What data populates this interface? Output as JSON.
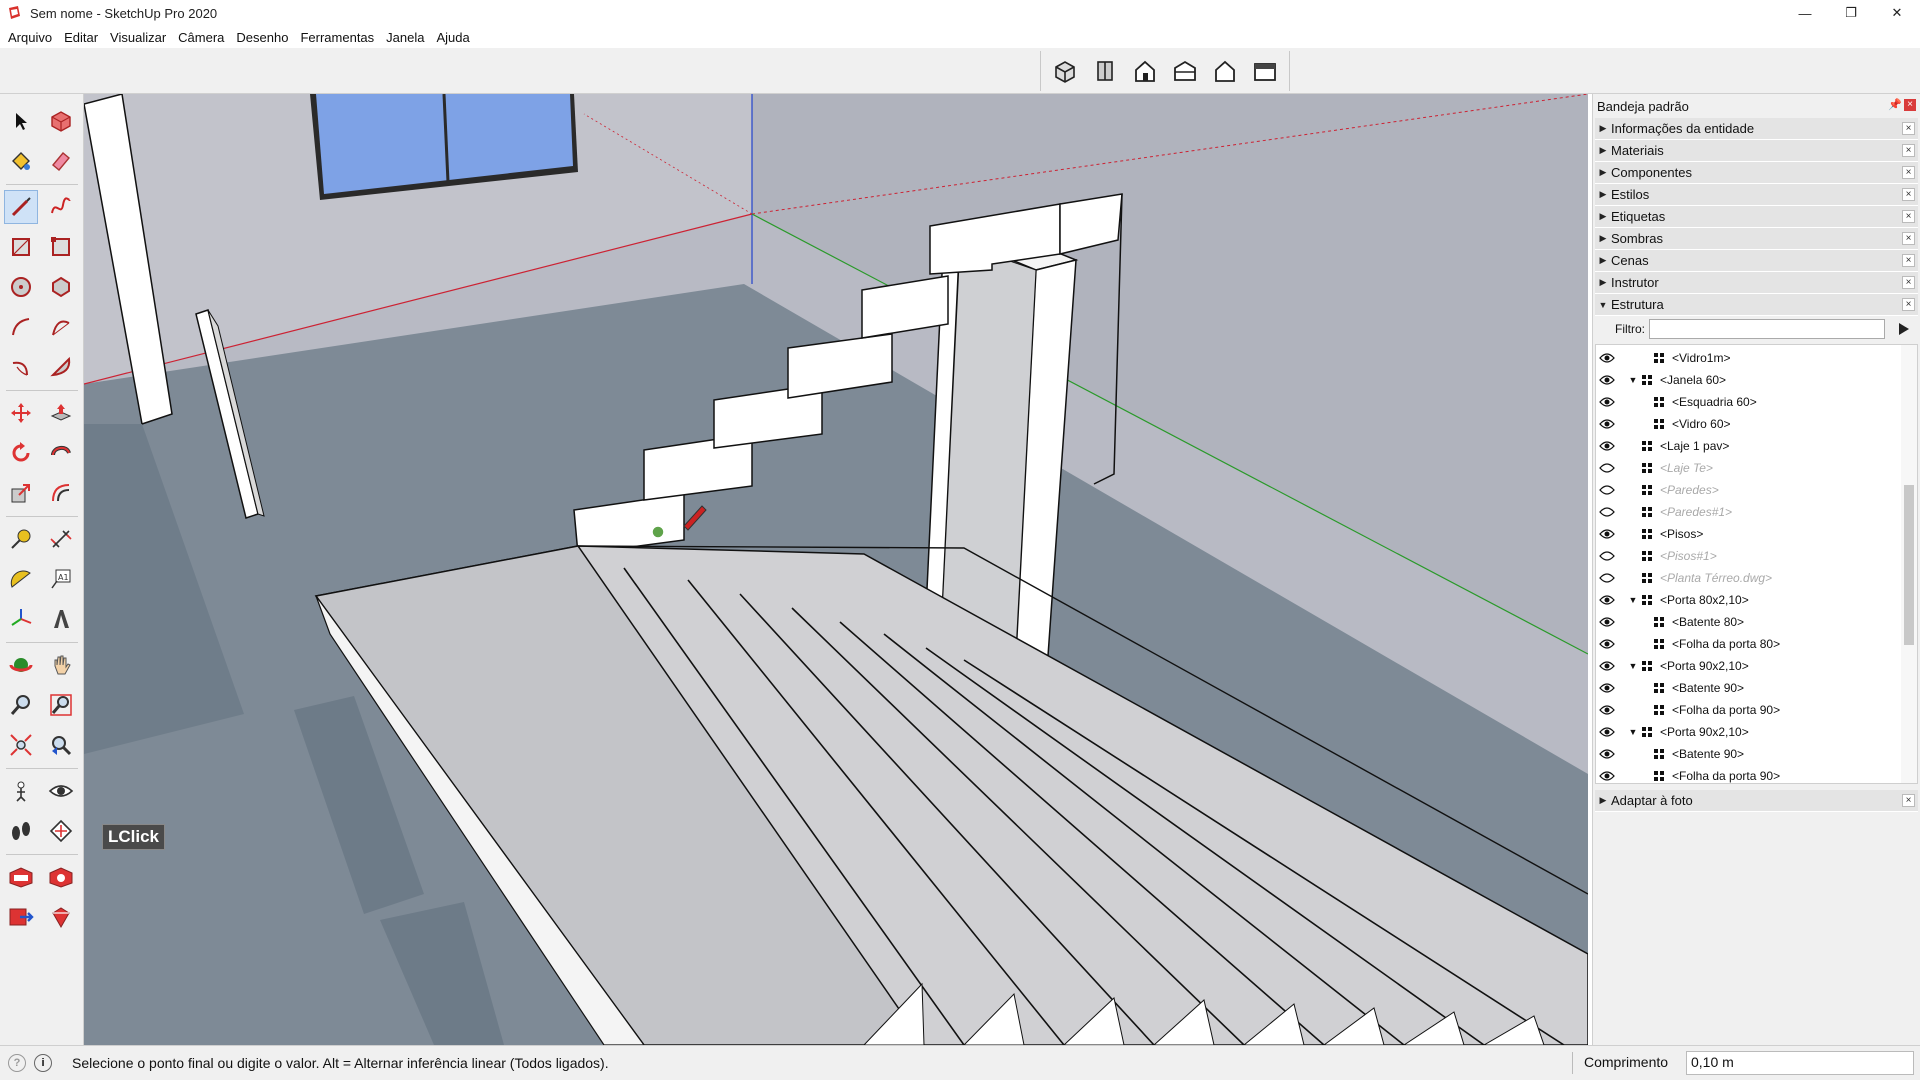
{
  "window": {
    "title": "Sem nome - SketchUp Pro 2020",
    "controls": {
      "minimize": "—",
      "restore": "❐",
      "close": "✕"
    }
  },
  "menu": [
    "Arquivo",
    "Editar",
    "Visualizar",
    "Câmera",
    "Desenho",
    "Ferramentas",
    "Janela",
    "Ajuda"
  ],
  "views_toolbar": [
    "iso-view-icon",
    "top-view-icon",
    "front-view-icon",
    "right-view-icon",
    "back-view-icon",
    "left-view-icon"
  ],
  "tools": [
    "select-icon",
    "make-component-icon",
    "paint-bucket-icon",
    "eraser-icon",
    "line-icon",
    "freehand-icon",
    "rectangle-icon",
    "rotated-rectangle-icon",
    "circle-icon",
    "polygon-icon",
    "arc-icon",
    "two-point-arc-icon",
    "three-point-arc-icon",
    "pie-icon",
    "move-icon",
    "push-pull-icon",
    "rotate-icon",
    "follow-me-icon",
    "scale-icon",
    "offset-icon",
    "tape-measure-icon",
    "dimension-icon",
    "protractor-icon",
    "text-icon",
    "axes-icon",
    "3d-text-icon",
    "orbit-icon",
    "pan-icon",
    "zoom-icon",
    "zoom-window-icon",
    "zoom-extents-icon",
    "previous-view-icon",
    "position-camera-icon",
    "look-around-icon",
    "walk-icon",
    "section-plane-icon",
    "warehouse-icon",
    "extension-warehouse-icon",
    "send-to-layout-icon",
    "extension-manager-icon"
  ],
  "viewport": {
    "overlay_label": "LClick"
  },
  "tray": {
    "title": "Bandeja padrão",
    "panels": [
      "Informações da entidade",
      "Materiais",
      "Componentes",
      "Estilos",
      "Etiquetas",
      "Sombras",
      "Cenas",
      "Instrutor"
    ],
    "outliner_title": "Estrutura",
    "filter_label": "Filtro:",
    "filter_value": "",
    "outliner": [
      {
        "label": "<Vidro1m>",
        "level": 1,
        "visible": true,
        "toggle": ""
      },
      {
        "label": "<Janela 60>",
        "level": 0,
        "visible": true,
        "toggle": "▼"
      },
      {
        "label": "<Esquadria 60>",
        "level": 1,
        "visible": true,
        "toggle": ""
      },
      {
        "label": "<Vidro 60>",
        "level": 1,
        "visible": true,
        "toggle": ""
      },
      {
        "label": "<Laje 1 pav>",
        "level": 0,
        "visible": true,
        "toggle": ""
      },
      {
        "label": "<Laje Te>",
        "level": 0,
        "visible": false,
        "toggle": ""
      },
      {
        "label": "<Paredes>",
        "level": 0,
        "visible": false,
        "toggle": ""
      },
      {
        "label": "<Paredes#1>",
        "level": 0,
        "visible": false,
        "toggle": ""
      },
      {
        "label": "<Pisos>",
        "level": 0,
        "visible": true,
        "toggle": ""
      },
      {
        "label": "<Pisos#1>",
        "level": 0,
        "visible": false,
        "toggle": ""
      },
      {
        "label": "<Planta Térreo.dwg>",
        "level": 0,
        "visible": false,
        "toggle": ""
      },
      {
        "label": "<Porta 80x2,10>",
        "level": 0,
        "visible": true,
        "toggle": "▼"
      },
      {
        "label": "<Batente 80>",
        "level": 1,
        "visible": true,
        "toggle": ""
      },
      {
        "label": "<Folha da porta 80>",
        "level": 1,
        "visible": true,
        "toggle": ""
      },
      {
        "label": "<Porta 90x2,10>",
        "level": 0,
        "visible": true,
        "toggle": "▼"
      },
      {
        "label": "<Batente 90>",
        "level": 1,
        "visible": true,
        "toggle": ""
      },
      {
        "label": "<Folha da porta 90>",
        "level": 1,
        "visible": true,
        "toggle": ""
      },
      {
        "label": "<Porta 90x2,10>",
        "level": 0,
        "visible": true,
        "toggle": "▼"
      },
      {
        "label": "<Batente 90>",
        "level": 1,
        "visible": true,
        "toggle": ""
      },
      {
        "label": "<Folha da porta 90>",
        "level": 1,
        "visible": true,
        "toggle": ""
      }
    ],
    "bottom_panel": "Adaptar à foto"
  },
  "status": {
    "message": "Selecione o ponto final ou digite o valor. Alt = Alternar inferência linear (Todos ligados).",
    "vcb_label": "Comprimento",
    "vcb_value": "0,10 m"
  }
}
